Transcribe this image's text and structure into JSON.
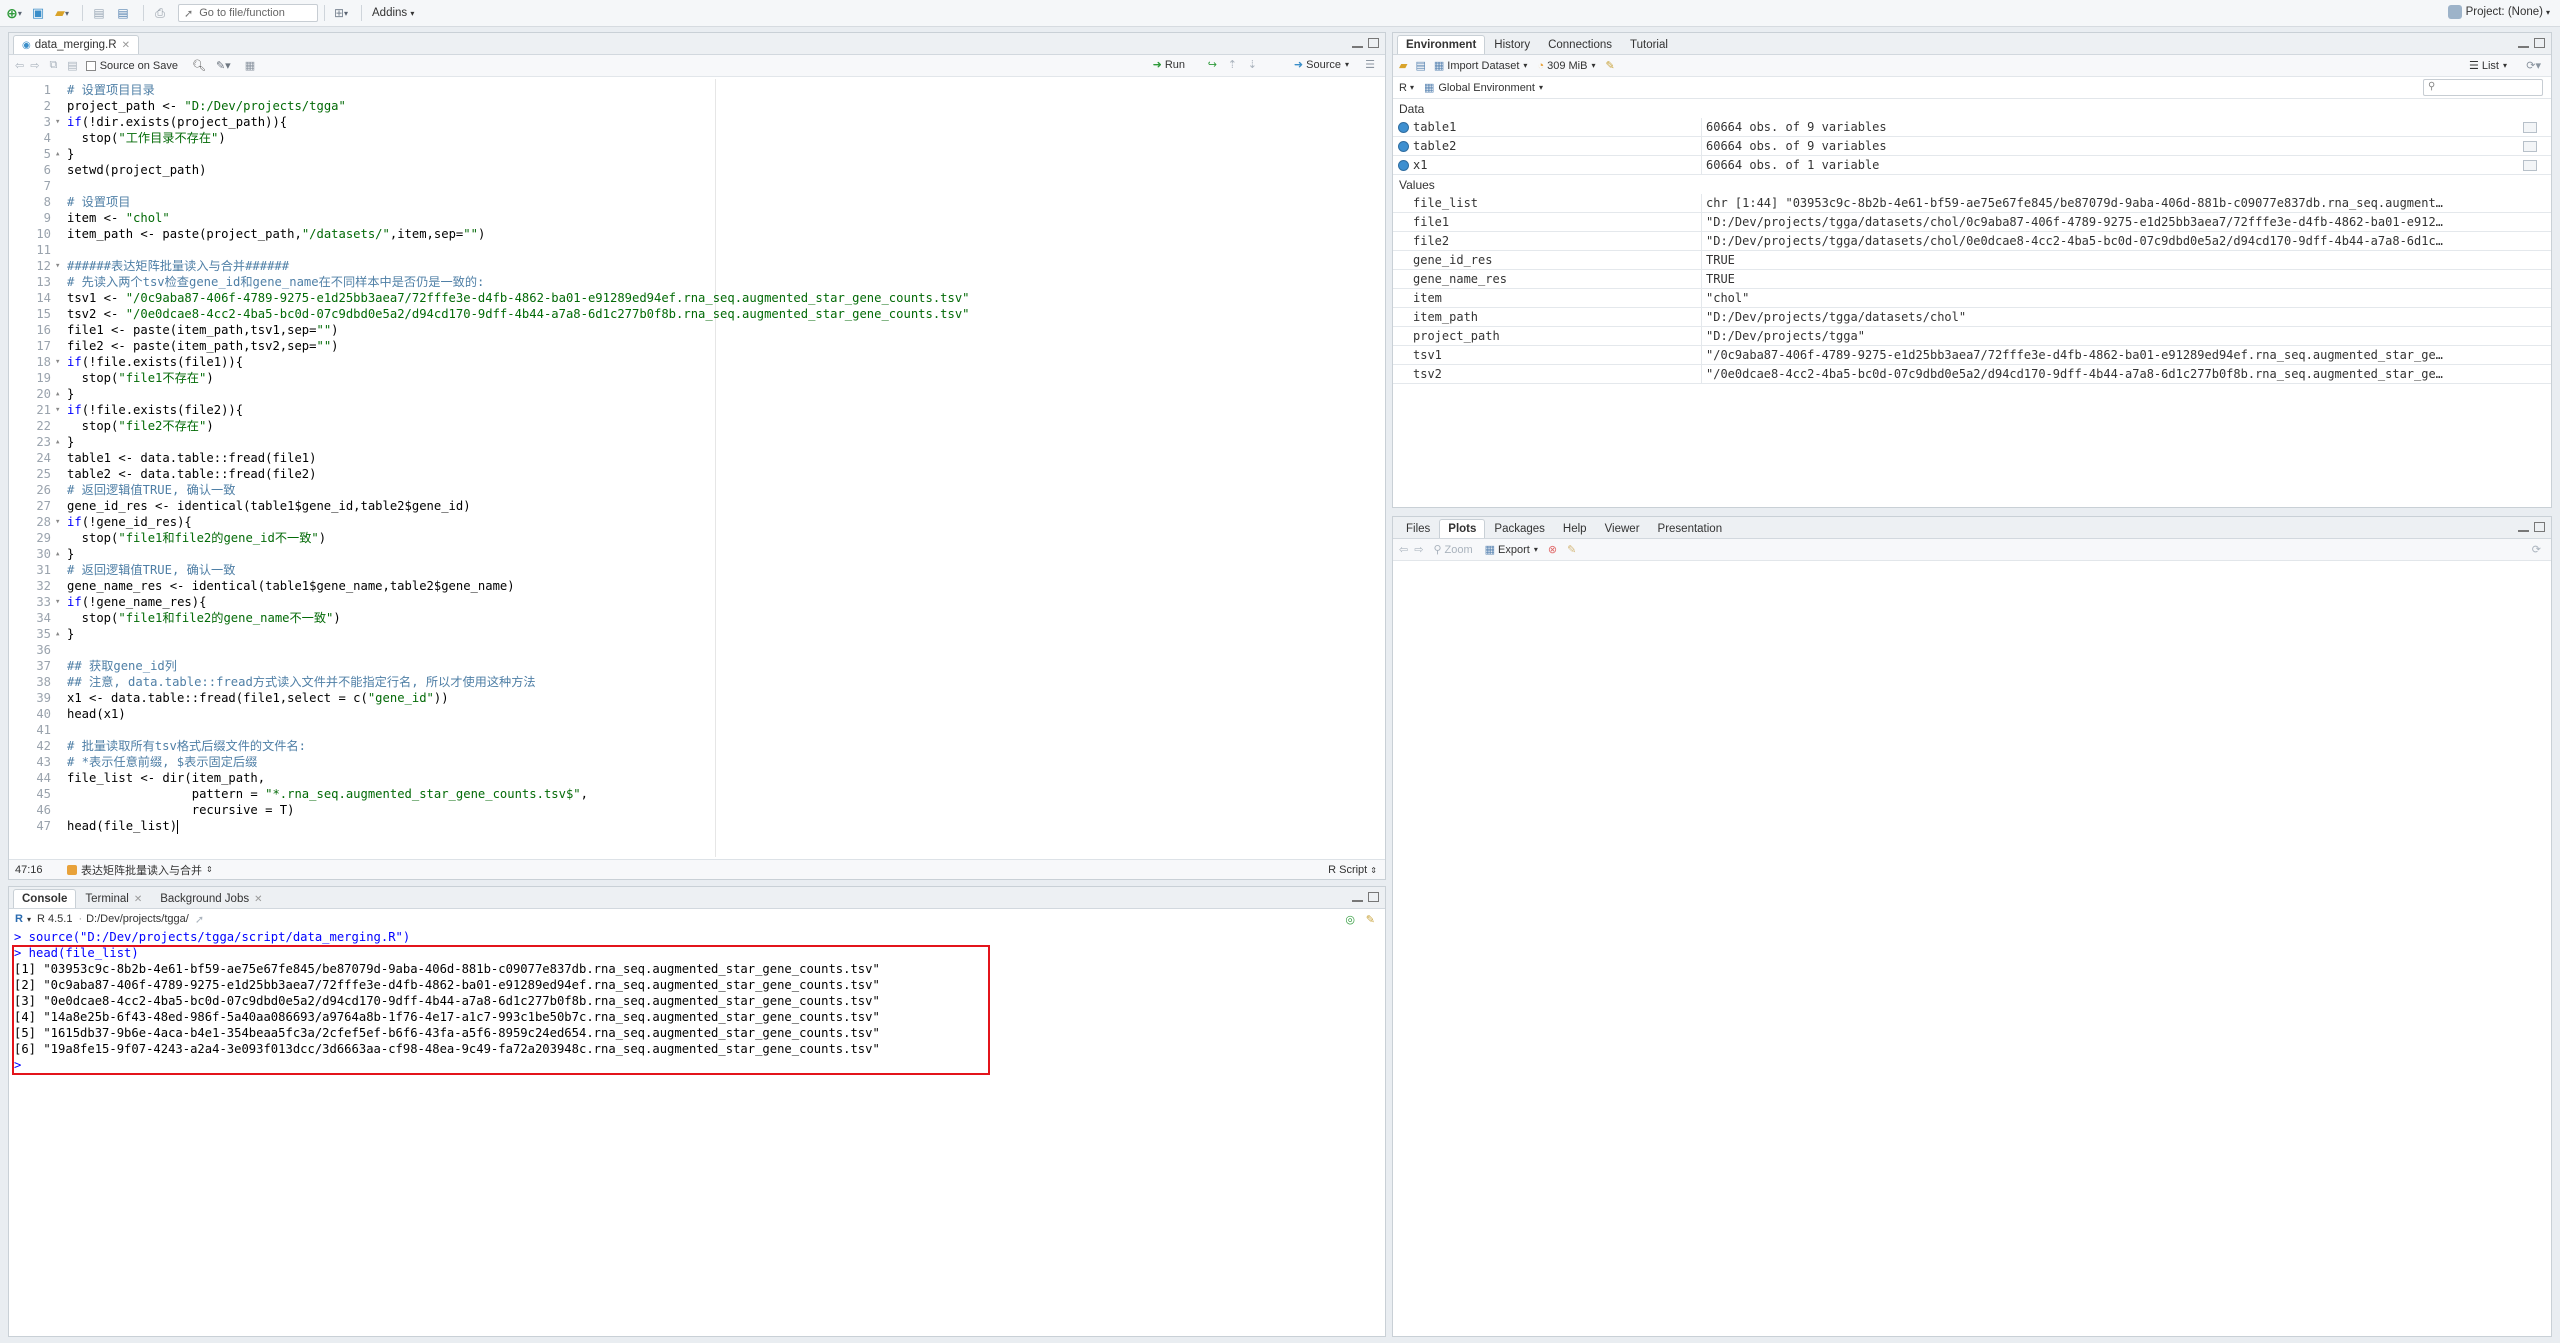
{
  "toolbar": {
    "goto_placeholder": "Go to file/function",
    "addins_label": "Addins",
    "project_label": "Project: (None)"
  },
  "editor": {
    "tab_label": "data_merging.R",
    "source_on_save_label": "Source on Save",
    "run_label": "Run",
    "source_label": "Source",
    "cursor_position": "47:16",
    "section_label": "表达矩阵批量读入与合并",
    "script_type": "R Script",
    "lines": [
      {
        "n": "1",
        "fold": "",
        "html": "<span class=\"cm\"># 设置项目目录</span>"
      },
      {
        "n": "2",
        "fold": "",
        "html": "project_path <- <span class=\"st\">\"D:/Dev/projects/tgga\"</span>"
      },
      {
        "n": "3",
        "fold": "▾",
        "html": "<span class=\"kw\">if</span>(!dir.exists(project_path)){"
      },
      {
        "n": "4",
        "fold": "",
        "html": "  stop(<span class=\"st\">\"工作目录不存在\"</span>)"
      },
      {
        "n": "5",
        "fold": "▴",
        "html": "}"
      },
      {
        "n": "6",
        "fold": "",
        "html": "setwd(project_path)"
      },
      {
        "n": "7",
        "fold": "",
        "html": ""
      },
      {
        "n": "8",
        "fold": "",
        "html": "<span class=\"cm\"># 设置项目</span>"
      },
      {
        "n": "9",
        "fold": "",
        "html": "item <- <span class=\"st\">\"chol\"</span>"
      },
      {
        "n": "10",
        "fold": "",
        "html": "item_path <- paste(project_path,<span class=\"st\">\"/datasets/\"</span>,item,sep=<span class=\"st\">\"\"</span>)"
      },
      {
        "n": "11",
        "fold": "",
        "html": ""
      },
      {
        "n": "12",
        "fold": "▾",
        "html": "<span class=\"cm\">######表达矩阵批量读入与合并######</span>"
      },
      {
        "n": "13",
        "fold": "",
        "html": "<span class=\"cm\"># 先读入两个tsv检查gene_id和gene_name在不同样本中是否仍是一致的:</span>"
      },
      {
        "n": "14",
        "fold": "",
        "html": "tsv1 <- <span class=\"st\">\"/0c9aba87-406f-4789-9275-e1d25bb3aea7/72fffe3e-d4fb-4862-ba01-e91289ed94ef.rna_seq.augmented_star_gene_counts.tsv\"</span>"
      },
      {
        "n": "15",
        "fold": "",
        "html": "tsv2 <- <span class=\"st\">\"/0e0dcae8-4cc2-4ba5-bc0d-07c9dbd0e5a2/d94cd170-9dff-4b44-a7a8-6d1c277b0f8b.rna_seq.augmented_star_gene_counts.tsv\"</span>"
      },
      {
        "n": "16",
        "fold": "",
        "html": "file1 <- paste(item_path,tsv1,sep=<span class=\"st\">\"\"</span>)"
      },
      {
        "n": "17",
        "fold": "",
        "html": "file2 <- paste(item_path,tsv2,sep=<span class=\"st\">\"\"</span>)"
      },
      {
        "n": "18",
        "fold": "▾",
        "html": "<span class=\"kw\">if</span>(!file.exists(file1)){"
      },
      {
        "n": "19",
        "fold": "",
        "html": "  stop(<span class=\"st\">\"file1不存在\"</span>)"
      },
      {
        "n": "20",
        "fold": "▴",
        "html": "}"
      },
      {
        "n": "21",
        "fold": "▾",
        "html": "<span class=\"kw\">if</span>(!file.exists(file2)){"
      },
      {
        "n": "22",
        "fold": "",
        "html": "  stop(<span class=\"st\">\"file2不存在\"</span>)"
      },
      {
        "n": "23",
        "fold": "▴",
        "html": "}"
      },
      {
        "n": "24",
        "fold": "",
        "html": "table1 <- data.table::fread(file1)"
      },
      {
        "n": "25",
        "fold": "",
        "html": "table2 <- data.table::fread(file2)"
      },
      {
        "n": "26",
        "fold": "",
        "html": "<span class=\"cm\"># 返回逻辑值TRUE, 确认一致</span>"
      },
      {
        "n": "27",
        "fold": "",
        "html": "gene_id_res <- identical(table1$gene_id,table2$gene_id)"
      },
      {
        "n": "28",
        "fold": "▾",
        "html": "<span class=\"kw\">if</span>(!gene_id_res){"
      },
      {
        "n": "29",
        "fold": "",
        "html": "  stop(<span class=\"st\">\"file1和file2的gene_id不一致\"</span>)"
      },
      {
        "n": "30",
        "fold": "▴",
        "html": "}"
      },
      {
        "n": "31",
        "fold": "",
        "html": "<span class=\"cm\"># 返回逻辑值TRUE, 确认一致</span>"
      },
      {
        "n": "32",
        "fold": "",
        "html": "gene_name_res <- identical(table1$gene_name,table2$gene_name)"
      },
      {
        "n": "33",
        "fold": "▾",
        "html": "<span class=\"kw\">if</span>(!gene_name_res){"
      },
      {
        "n": "34",
        "fold": "",
        "html": "  stop(<span class=\"st\">\"file1和file2的gene_name不一致\"</span>)"
      },
      {
        "n": "35",
        "fold": "▴",
        "html": "}"
      },
      {
        "n": "36",
        "fold": "",
        "html": ""
      },
      {
        "n": "37",
        "fold": "",
        "html": "<span class=\"cm\">## 获取gene_id列</span>"
      },
      {
        "n": "38",
        "fold": "",
        "html": "<span class=\"cm\">## 注意, data.table::fread方式读入文件并不能指定行名, 所以才使用这种方法</span>"
      },
      {
        "n": "39",
        "fold": "",
        "html": "x1 <- data.table::fread(file1,select = c(<span class=\"st\">\"gene_id\"</span>))"
      },
      {
        "n": "40",
        "fold": "",
        "html": "head(x1)"
      },
      {
        "n": "41",
        "fold": "",
        "html": ""
      },
      {
        "n": "42",
        "fold": "",
        "html": "<span class=\"cm\"># 批量读取所有tsv格式后缀文件的文件名:</span>"
      },
      {
        "n": "43",
        "fold": "",
        "html": "<span class=\"cm\"># *表示任意前缀, $表示固定后缀</span>"
      },
      {
        "n": "44",
        "fold": "",
        "html": "file_list <- dir(item_path,"
      },
      {
        "n": "45",
        "fold": "",
        "html": "                 pattern = <span class=\"st\">\"*.rna_seq.augmented_star_gene_counts.tsv$\"</span>,"
      },
      {
        "n": "46",
        "fold": "",
        "html": "                 recursive = T)"
      },
      {
        "n": "47",
        "fold": "",
        "html": "head(file_list)"
      }
    ]
  },
  "console": {
    "tabs": [
      "Console",
      "Terminal",
      "Background Jobs"
    ],
    "r_version": "R 4.5.1",
    "working_dir": "D:/Dev/projects/tgga/",
    "lines": [
      {
        "cls": "prompt",
        "text": "> source(\"D:/Dev/projects/tgga/script/data_merging.R\")"
      },
      {
        "cls": "prompt",
        "text": "> head(file_list)"
      },
      {
        "cls": "out",
        "text": "[1] \"03953c9c-8b2b-4e61-bf59-ae75e67fe845/be87079d-9aba-406d-881b-c09077e837db.rna_seq.augmented_star_gene_counts.tsv\""
      },
      {
        "cls": "out",
        "text": "[2] \"0c9aba87-406f-4789-9275-e1d25bb3aea7/72fffe3e-d4fb-4862-ba01-e91289ed94ef.rna_seq.augmented_star_gene_counts.tsv\""
      },
      {
        "cls": "out",
        "text": "[3] \"0e0dcae8-4cc2-4ba5-bc0d-07c9dbd0e5a2/d94cd170-9dff-4b44-a7a8-6d1c277b0f8b.rna_seq.augmented_star_gene_counts.tsv\""
      },
      {
        "cls": "out",
        "text": "[4] \"14a8e25b-6f43-48ed-986f-5a40aa086693/a9764a8b-1f76-4e17-a1c7-993c1be50b7c.rna_seq.augmented_star_gene_counts.tsv\""
      },
      {
        "cls": "out",
        "text": "[5] \"1615db37-9b6e-4aca-b4e1-354beaa5fc3a/2cfef5ef-b6f6-43fa-a5f6-8959c24ed654.rna_seq.augmented_star_gene_counts.tsv\""
      },
      {
        "cls": "out",
        "text": "[6] \"19a8fe15-9f07-4243-a2a4-3e093f013dcc/3d6663aa-cf98-48ea-9c49-fa72a203948c.rna_seq.augmented_star_gene_counts.tsv\""
      },
      {
        "cls": "prompt",
        "text": "> "
      }
    ]
  },
  "environment": {
    "tabs": [
      "Environment",
      "History",
      "Connections",
      "Tutorial"
    ],
    "import_dataset_label": "Import Dataset",
    "memory_label": "309 MiB",
    "list_label": "List",
    "lang_label": "R",
    "scope_label": "Global Environment",
    "data_section": "Data",
    "values_section": "Values",
    "data": [
      {
        "name": "table1",
        "value": "60664 obs. of 9 variables"
      },
      {
        "name": "table2",
        "value": "60664 obs. of 9 variables"
      },
      {
        "name": "x1",
        "value": "60664 obs. of 1 variable"
      }
    ],
    "values": [
      {
        "name": "file_list",
        "value": "chr [1:44] \"03953c9c-8b2b-4e61-bf59-ae75e67fe845/be87079d-9aba-406d-881b-c09077e837db.rna_seq.augment…"
      },
      {
        "name": "file1",
        "value": "\"D:/Dev/projects/tgga/datasets/chol/0c9aba87-406f-4789-9275-e1d25bb3aea7/72fffe3e-d4fb-4862-ba01-e912…"
      },
      {
        "name": "file2",
        "value": "\"D:/Dev/projects/tgga/datasets/chol/0e0dcae8-4cc2-4ba5-bc0d-07c9dbd0e5a2/d94cd170-9dff-4b44-a7a8-6d1c…"
      },
      {
        "name": "gene_id_res",
        "value": "TRUE"
      },
      {
        "name": "gene_name_res",
        "value": "TRUE"
      },
      {
        "name": "item",
        "value": "\"chol\""
      },
      {
        "name": "item_path",
        "value": "\"D:/Dev/projects/tgga/datasets/chol\""
      },
      {
        "name": "project_path",
        "value": "\"D:/Dev/projects/tgga\""
      },
      {
        "name": "tsv1",
        "value": "\"/0c9aba87-406f-4789-9275-e1d25bb3aea7/72fffe3e-d4fb-4862-ba01-e91289ed94ef.rna_seq.augmented_star_ge…"
      },
      {
        "name": "tsv2",
        "value": "\"/0e0dcae8-4cc2-4ba5-bc0d-07c9dbd0e5a2/d94cd170-9dff-4b44-a7a8-6d1c277b0f8b.rna_seq.augmented_star_ge…"
      }
    ]
  },
  "files_pane": {
    "tabs": [
      "Files",
      "Plots",
      "Packages",
      "Help",
      "Viewer",
      "Presentation"
    ],
    "zoom_label": "Zoom",
    "export_label": "Export"
  }
}
